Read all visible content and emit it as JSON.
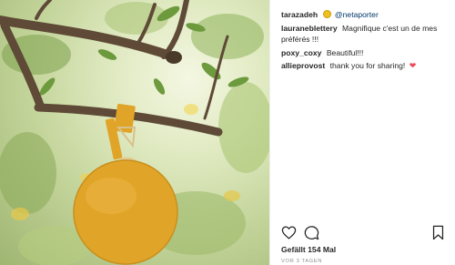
{
  "post": {
    "caption": {
      "username": "tarazadeh",
      "emoji": "lemon-emoji",
      "mention": "@netaporter"
    },
    "comments": [
      {
        "username": "lauraneblettery",
        "text": "Magnifique c'est un de mes préférés !!!"
      },
      {
        "username": "poxy_coxy",
        "text": "Beautiful!!!"
      },
      {
        "username": "allieprovost",
        "text": "thank you for sharing!"
      }
    ],
    "likes_label": "Gefällt 154 Mal",
    "timestamp": "VOR 3 TAGEN"
  },
  "icons": {
    "like": "heart-outline-icon",
    "comment": "comment-bubble-icon",
    "save": "bookmark-icon",
    "comment_emoji": "red-heart-icon"
  },
  "colors": {
    "bag": "#e0a528",
    "heart": "#ed4956",
    "mention": "#00376b",
    "muted": "#8e8e8e"
  }
}
